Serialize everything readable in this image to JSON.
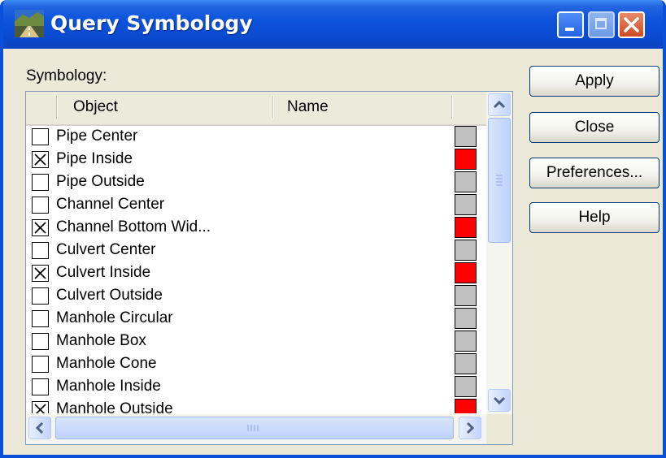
{
  "window": {
    "title": "Query Symbology",
    "controls": {
      "minimize": "minimize",
      "maximize": "maximize (disabled)",
      "close": "close"
    }
  },
  "symbology_label": "Symbology:",
  "list": {
    "columns": [
      "Object",
      "Name"
    ],
    "rows": [
      {
        "label": "Pipe Center",
        "checked": false,
        "color": "#c0c0c0"
      },
      {
        "label": "Pipe Inside",
        "checked": true,
        "color": "#ff0000"
      },
      {
        "label": "Pipe Outside",
        "checked": false,
        "color": "#c0c0c0"
      },
      {
        "label": "Channel Center",
        "checked": false,
        "color": "#c0c0c0"
      },
      {
        "label": "Channel Bottom Wid...",
        "checked": true,
        "color": "#ff0000"
      },
      {
        "label": "Culvert Center",
        "checked": false,
        "color": "#c0c0c0"
      },
      {
        "label": "Culvert Inside",
        "checked": true,
        "color": "#ff0000"
      },
      {
        "label": "Culvert Outside",
        "checked": false,
        "color": "#c0c0c0"
      },
      {
        "label": "Manhole Circular",
        "checked": false,
        "color": "#c0c0c0"
      },
      {
        "label": "Manhole Box",
        "checked": false,
        "color": "#c0c0c0"
      },
      {
        "label": "Manhole Cone",
        "checked": false,
        "color": "#c0c0c0"
      },
      {
        "label": "Manhole Inside",
        "checked": false,
        "color": "#c0c0c0"
      },
      {
        "label": "Manhole Outside",
        "checked": true,
        "color": "#ff0000"
      }
    ]
  },
  "buttons": {
    "apply": "Apply",
    "close": "Close",
    "preferences": "Preferences...",
    "help": "Help"
  },
  "colors": {
    "titlebar": "#0a4ad0",
    "dialog_bg": "#ece9d8",
    "checked_swatch": "#ff0000",
    "unchecked_swatch": "#c0c0c0"
  }
}
